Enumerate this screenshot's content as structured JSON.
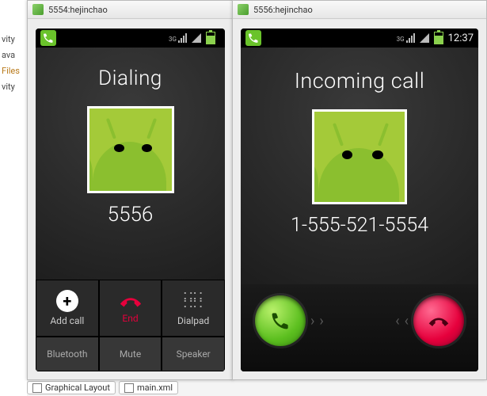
{
  "side_strip": {
    "items": [
      "vity",
      "ava",
      "Files",
      "vity"
    ]
  },
  "bottom_tabs": {
    "graphical": "Graphical Layout",
    "mainxml": "main.xml"
  },
  "emulator_left": {
    "window_title": "5554:hejinchao",
    "statusbar": {
      "clock": ""
    },
    "call_title": "Dialing",
    "number": "5556",
    "buttons": {
      "add_call": "Add call",
      "end": "End",
      "dialpad": "Dialpad",
      "bluetooth": "Bluetooth",
      "mute": "Mute",
      "speaker": "Speaker"
    }
  },
  "emulator_right": {
    "window_title": "5556:hejinchao",
    "statusbar": {
      "clock": "12:37"
    },
    "call_title": "Incoming call",
    "number": "1-555-521-5554"
  }
}
